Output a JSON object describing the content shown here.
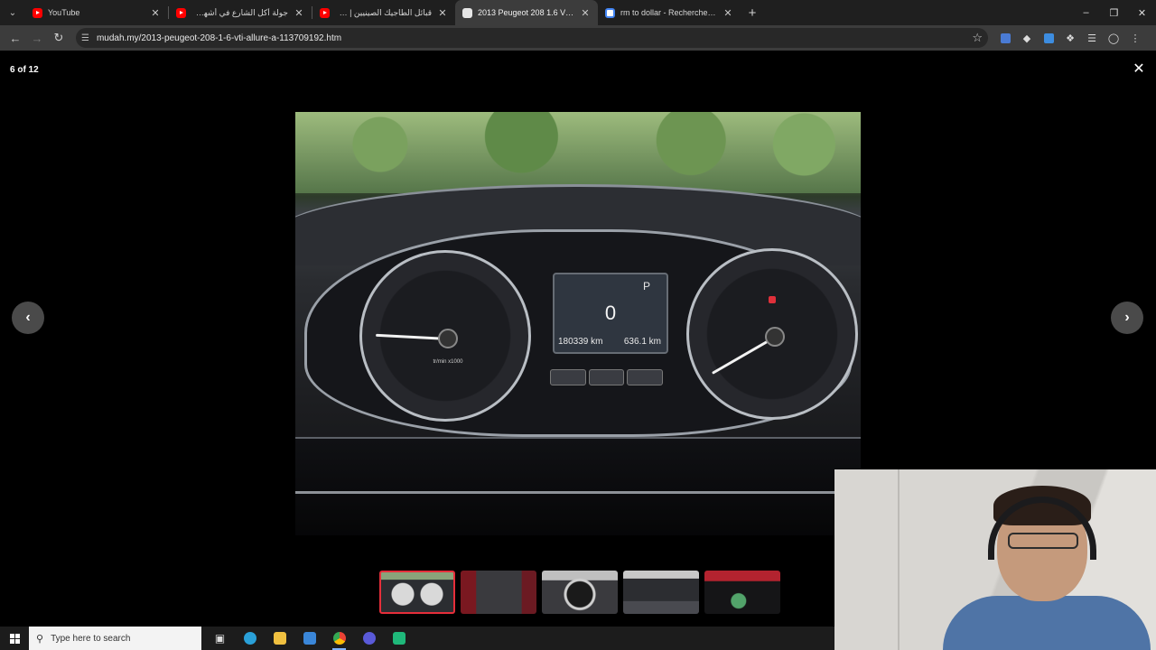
{
  "tabs": [
    {
      "title": "YouTube",
      "favicon": "youtube-icon",
      "active": false
    },
    {
      "title": "جولة أكل الشارع في أشهر شارع ...",
      "favicon": "youtube-icon",
      "active": false
    },
    {
      "title": "قبائل الطاجيك الصينيين | مسلمو...",
      "favicon": "youtube-icon",
      "active": false
    },
    {
      "title": "2013 Peugeot 208 1.6 VTi ALLURE",
      "favicon": "document-icon",
      "active": true
    },
    {
      "title": "rm to dollar - Recherche Google",
      "favicon": "google-icon",
      "active": false
    }
  ],
  "address_bar": {
    "url": "mudah.my/2013-peugeot-208-1-6-vti-allure-a-113709192.htm"
  },
  "gallery": {
    "counter": "6 of 12",
    "lcd": {
      "gear": "P",
      "speed": "0",
      "odometer": "180339 km",
      "range": "636.1 km"
    },
    "left_gauge_label": "tr/min x1000",
    "thumbnail_count": 5,
    "active_thumbnail": 1
  },
  "taskbar": {
    "search_placeholder": "Type here to search"
  },
  "colors": {
    "accent_red": "#e62e3a",
    "chrome_dark": "#1f1f1f",
    "toolbar": "#3c3c3c"
  }
}
